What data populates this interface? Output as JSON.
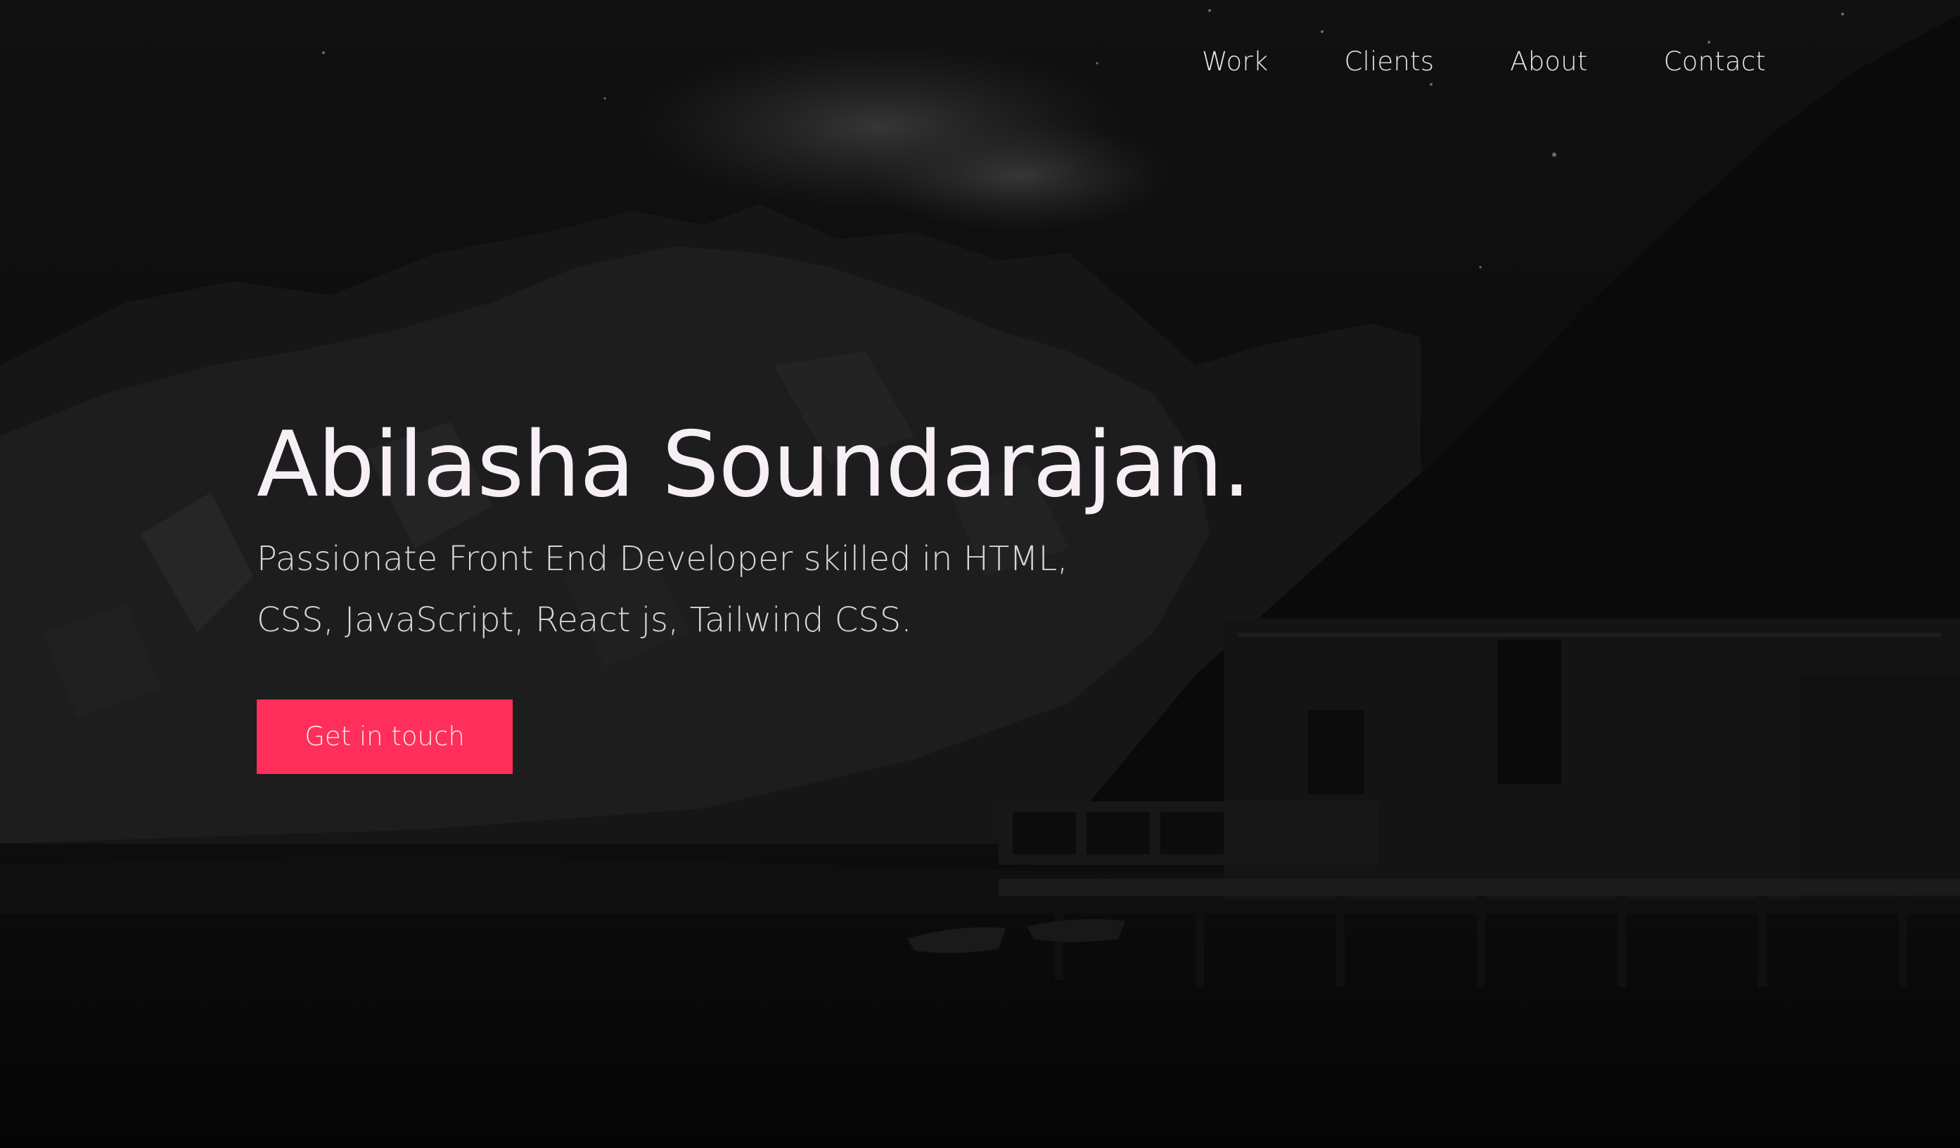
{
  "nav": {
    "items": [
      {
        "label": "Work"
      },
      {
        "label": "Clients"
      },
      {
        "label": "About"
      },
      {
        "label": "Contact"
      }
    ]
  },
  "hero": {
    "name": "Abilasha Soundarajan.",
    "tagline": "Passionate Front End Developer skilled in HTML, CSS, JavaScript, React js, Tailwind CSS.",
    "cta_label": "Get in touch"
  },
  "colors": {
    "accent": "#ff2e5b",
    "background": "#070707",
    "text": "#f6f0f6"
  }
}
